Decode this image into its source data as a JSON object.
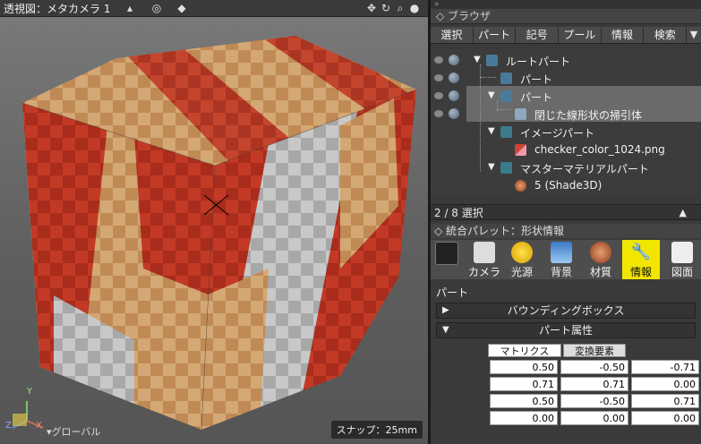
{
  "viewport": {
    "title": "透視図：メタカメラ 1",
    "snap": "スナップ：25mm",
    "coord_mode": "▾グローバル",
    "axis_y": "Y",
    "axis_x": "X",
    "axis_z": "Z"
  },
  "browser": {
    "title": "ブラウザ",
    "tabs": [
      "選択",
      "パート",
      "記号",
      "プール",
      "情報",
      "検索"
    ],
    "tree": [
      {
        "label": "ルートパート"
      },
      {
        "label": "パート"
      },
      {
        "label": "パート"
      },
      {
        "label": "閉じた線形状の掃引体"
      },
      {
        "label": "イメージパート"
      },
      {
        "label": "checker_color_1024.png"
      },
      {
        "label": "マスターマテリアルパート"
      },
      {
        "label": "5 (Shade3D)"
      }
    ],
    "selection": "2 / 8 選択"
  },
  "palette": {
    "title": "統合パレット：形状情報",
    "tabs": [
      "カメラ",
      "光源",
      "背景",
      "材質",
      "情報",
      "図面"
    ],
    "part_label": "パート",
    "bbox_section": "バウンディングボックス",
    "attr_section": "パート属性",
    "subtabs": [
      "マトリクス",
      "変換要素"
    ],
    "matrix": [
      [
        "0.50",
        "-0.50",
        "-0.71"
      ],
      [
        "0.71",
        "0.71",
        "0.00"
      ],
      [
        "0.50",
        "-0.50",
        "0.71"
      ],
      [
        "0.00",
        "0.00",
        "0.00"
      ]
    ]
  },
  "colors": {
    "accent_yellow": "#f2e600",
    "cube_red": "#b83220",
    "cube_tan": "#c9a070",
    "cube_gray": "#b9b9b9"
  }
}
